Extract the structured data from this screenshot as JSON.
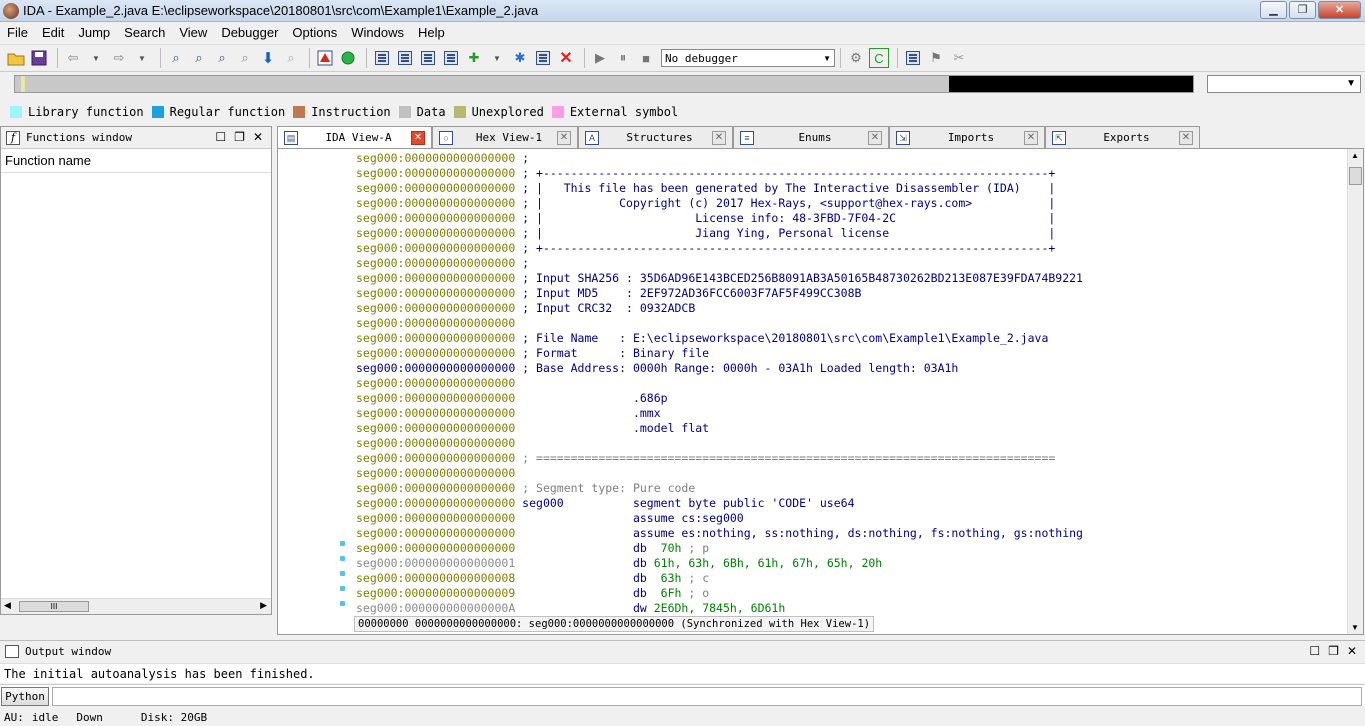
{
  "window": {
    "title": "IDA - Example_2.java E:\\eclipseworkspace\\20180801\\src\\com\\Example1\\Example_2.java",
    "minimize": "▁",
    "maximize": "❐",
    "close": "✕"
  },
  "menu": [
    "File",
    "Edit",
    "Jump",
    "Search",
    "View",
    "Debugger",
    "Options",
    "Windows",
    "Help"
  ],
  "toolbar": {
    "debugger_select": "No debugger"
  },
  "legend": [
    {
      "label": "Library function",
      "color": "#9ff5ff"
    },
    {
      "label": "Regular function",
      "color": "#1ea0e0"
    },
    {
      "label": "Instruction",
      "color": "#c07850"
    },
    {
      "label": "Data",
      "color": "#c0c0c0"
    },
    {
      "label": "Unexplored",
      "color": "#b8b870"
    },
    {
      "label": "External symbol",
      "color": "#ff9ee8"
    }
  ],
  "functions_window": {
    "title": "Functions window",
    "column": "Function name",
    "scroll_thumb": "III"
  },
  "tabs": [
    {
      "label": "IDA View-A",
      "icon": "ida-view-icon",
      "active": true
    },
    {
      "label": "Hex View-1",
      "icon": "hex-view-icon",
      "active": false
    },
    {
      "label": "Structures",
      "icon": "structures-icon",
      "active": false
    },
    {
      "label": "Enums",
      "icon": "enums-icon",
      "active": false
    },
    {
      "label": "Imports",
      "icon": "imports-icon",
      "active": false
    },
    {
      "label": "Exports",
      "icon": "exports-icon",
      "active": false
    }
  ],
  "disasm": {
    "lines": [
      {
        "addr": "seg000:0000000000000000",
        "text": " ;",
        "kind": "cmt"
      },
      {
        "addr": "seg000:0000000000000000",
        "text": " ; +-------------------------------------------------------------------------+",
        "kind": "cmt"
      },
      {
        "addr": "seg000:0000000000000000",
        "text": " ; |   This file has been generated by The Interactive Disassembler (IDA)    |",
        "kind": "cmt"
      },
      {
        "addr": "seg000:0000000000000000",
        "text": " ; |           Copyright (c) 2017 Hex-Rays, <support@hex-rays.com>           |",
        "kind": "cmt"
      },
      {
        "addr": "seg000:0000000000000000",
        "text": " ; |                      License info: 48-3FBD-7F04-2C                      |",
        "kind": "cmt"
      },
      {
        "addr": "seg000:0000000000000000",
        "text": " ; |                      Jiang Ying, Personal license                       |",
        "kind": "cmt"
      },
      {
        "addr": "seg000:0000000000000000",
        "text": " ; +-------------------------------------------------------------------------+",
        "kind": "cmt"
      },
      {
        "addr": "seg000:0000000000000000",
        "text": " ;",
        "kind": "cmt"
      },
      {
        "addr": "seg000:0000000000000000",
        "text": " ; Input SHA256 : 35D6AD96E143BCED256B8091AB3A50165B48730262BD213E087E39FDA74B9221",
        "kind": "cmt"
      },
      {
        "addr": "seg000:0000000000000000",
        "text": " ; Input MD5    : 2EF972AD36FCC6003F7AF5F499CC308B",
        "kind": "cmt"
      },
      {
        "addr": "seg000:0000000000000000",
        "text": " ; Input CRC32  : 0932ADCB",
        "kind": "cmt"
      },
      {
        "addr": "seg000:0000000000000000",
        "text": "",
        "kind": "cmt"
      },
      {
        "addr": "seg000:0000000000000000",
        "text": " ; File Name   : E:\\eclipseworkspace\\20180801\\src\\com\\Example1\\Example_2.java",
        "kind": "cmt"
      },
      {
        "addr": "seg000:0000000000000000",
        "text": " ; Format      : Binary file",
        "kind": "cmt"
      },
      {
        "addr": "seg000:0000000000000000",
        "text": " ; Base Address: 0000h Range: 0000h - 03A1h Loaded length: 03A1h",
        "kind": "cmt",
        "addr_blue": true
      },
      {
        "addr": "seg000:0000000000000000",
        "text": "",
        "kind": "cmt"
      },
      {
        "addr": "seg000:0000000000000000",
        "text": "                 .686p",
        "kind": "cmt"
      },
      {
        "addr": "seg000:0000000000000000",
        "text": "                 .mmx",
        "kind": "cmt"
      },
      {
        "addr": "seg000:0000000000000000",
        "text": "                 .model flat",
        "kind": "cmt"
      },
      {
        "addr": "seg000:0000000000000000",
        "text": "",
        "kind": "cmt"
      },
      {
        "addr": "seg000:0000000000000000",
        "text": " ; ===========================================================================",
        "kind": "cmtg"
      },
      {
        "addr": "seg000:0000000000000000",
        "text": "",
        "kind": "cmt"
      },
      {
        "addr": "seg000:0000000000000000",
        "text": " ; Segment type: Pure code",
        "kind": "cmtg"
      },
      {
        "addr": "seg000:0000000000000000",
        "text": " seg000          segment byte public 'CODE' use64",
        "kind": "cmt"
      },
      {
        "addr": "seg000:0000000000000000",
        "text": "                 assume cs:seg000",
        "kind": "cmt"
      },
      {
        "addr": "seg000:0000000000000000",
        "text": "                 assume es:nothing, ss:nothing, ds:nothing, fs:nothing, gs:nothing",
        "kind": "cmt"
      },
      {
        "addr": "seg000:0000000000000000",
        "text": "                 db  70h ; p",
        "kind": "db"
      },
      {
        "addr": "seg000:0000000000000001",
        "text": "                 db 61h, 63h, 6Bh, 61h, 67h, 65h, 20h",
        "kind": "db",
        "addr_gray": true
      },
      {
        "addr": "seg000:0000000000000008",
        "text": "                 db  63h ; c",
        "kind": "db"
      },
      {
        "addr": "seg000:0000000000000009",
        "text": "                 db  6Fh ; o",
        "kind": "db"
      },
      {
        "addr": "seg000:000000000000000A",
        "text": "                 dw 2E6Dh, 7845h, 6D61h",
        "kind": "db",
        "addr_gray": true
      }
    ],
    "status": "00000000 0000000000000000: seg000:0000000000000000 (Synchronized with Hex View-1)"
  },
  "output": {
    "title": "Output window",
    "text": "The initial autoanalysis has been finished.",
    "python_button": "Python"
  },
  "statusbar": {
    "au_label": "AU:",
    "au_state": "idle",
    "direction": "Down",
    "disk": "Disk: 20GB"
  }
}
